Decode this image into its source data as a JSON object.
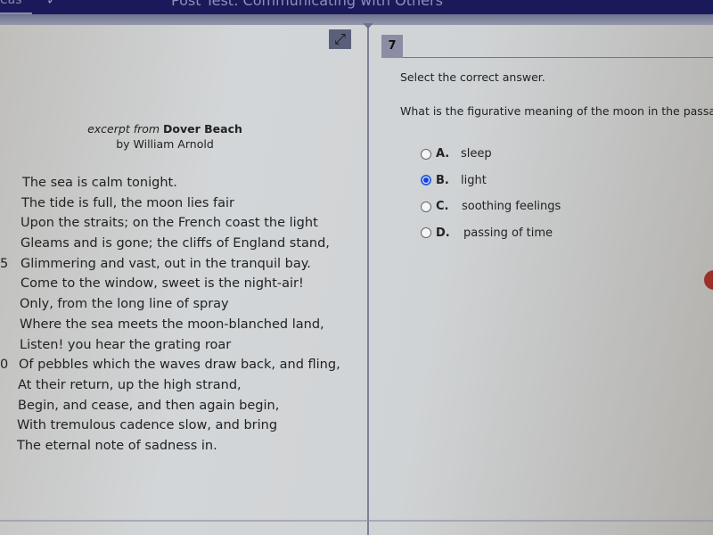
{
  "header": {
    "back_label": "eas",
    "check_icon": "checkmark-icon",
    "title": "Post Test: Communicating with Others"
  },
  "toolbar": {
    "expand_icon": "expand-arrows-icon",
    "expand_glyph": "⤢"
  },
  "question": {
    "number": "7",
    "instruction": "Select the correct answer.",
    "prompt": "What is the figurative meaning of the moon in the passage?",
    "options": [
      {
        "letter": "A.",
        "text": "sleep",
        "selected": false
      },
      {
        "letter": "B.",
        "text": "light",
        "selected": true
      },
      {
        "letter": "C.",
        "text": "soothing feelings",
        "selected": false
      },
      {
        "letter": "D.",
        "text": "passing of time",
        "selected": false
      }
    ]
  },
  "passage": {
    "excerpt_prefix": "excerpt from",
    "title": "Dover Beach",
    "byline": "by William Arnold",
    "lines": [
      {
        "num": "",
        "text": "The sea is calm tonight."
      },
      {
        "num": "",
        "text": "The tide is full, the moon lies fair"
      },
      {
        "num": "",
        "text": "Upon the straits; on the French coast the light"
      },
      {
        "num": "",
        "text": "Gleams and is gone; the cliffs of England stand,"
      },
      {
        "num": "5",
        "text": "Glimmering and vast, out in the tranquil bay."
      },
      {
        "num": "",
        "text": "Come to the window, sweet is the night-air!"
      },
      {
        "num": "",
        "text": "Only, from the long line of spray"
      },
      {
        "num": "",
        "text": "Where the sea meets the moon-blanched land,"
      },
      {
        "num": "",
        "text": "Listen! you hear the grating roar"
      },
      {
        "num": "0",
        "text": "Of pebbles which the waves draw back, and fling,"
      },
      {
        "num": "",
        "text": "At their return, up the high strand,"
      },
      {
        "num": "",
        "text": "Begin, and cease, and then again begin,"
      },
      {
        "num": "",
        "text": "With tremulous cadence slow, and bring"
      },
      {
        "num": "",
        "text": "The eternal note of sadness in."
      }
    ]
  },
  "colors": {
    "header_bg": "#1a1a5a",
    "radio_selected": "#1a3fd6",
    "qnum_bg": "#8a8da3"
  }
}
